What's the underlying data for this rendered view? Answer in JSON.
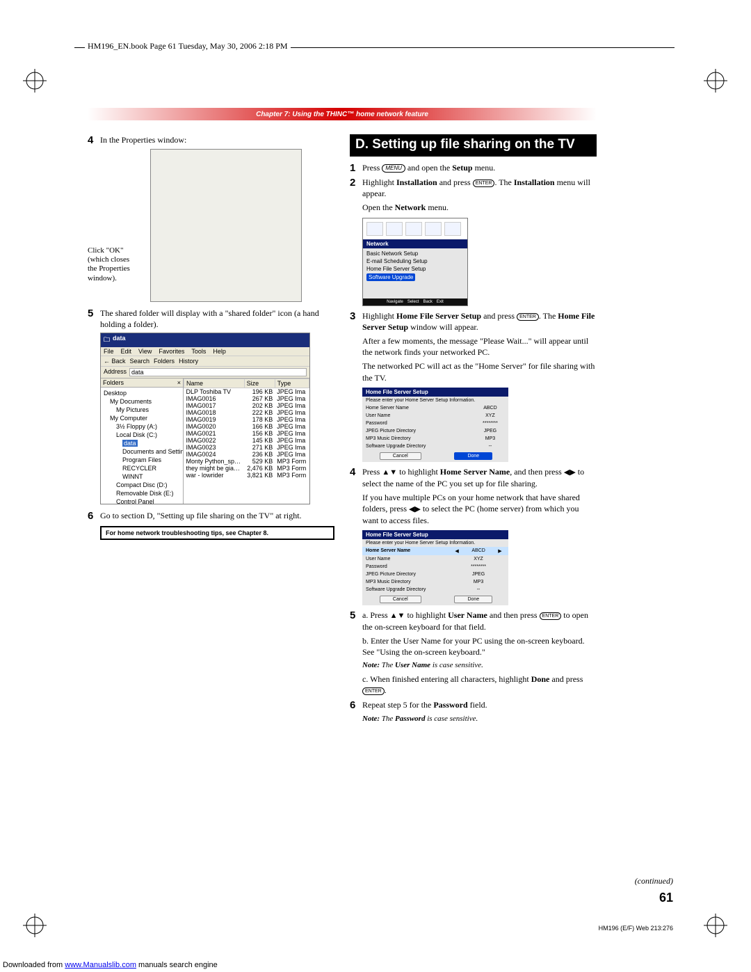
{
  "book_header": "HM196_EN.book  Page 61  Tuesday, May 30, 2006  2:18 PM",
  "chapter_banner": "Chapter 7: Using the THINC™ home network feature",
  "left": {
    "step4_num": "4",
    "step4_text": "In the Properties window:",
    "ok_callout_l1": "Click \"OK\"",
    "ok_callout_l2": "(which closes",
    "ok_callout_l3": "the Properties",
    "ok_callout_l4": "window).",
    "step5_num": "5",
    "step5_text": "The shared folder will display with a \"shared folder\" icon (a hand holding a folder).",
    "explorer": {
      "title": "data",
      "menu": [
        "File",
        "Edit",
        "View",
        "Favorites",
        "Tools",
        "Help"
      ],
      "toolbar": [
        "Back",
        "Search",
        "Folders",
        "History"
      ],
      "addr_label": "Address",
      "addr_value": "data",
      "tree_hdr": "Folders",
      "tree": [
        {
          "lbl": "Desktop",
          "lv": 0
        },
        {
          "lbl": "My Documents",
          "lv": 1
        },
        {
          "lbl": "My Pictures",
          "lv": 2
        },
        {
          "lbl": "My Computer",
          "lv": 1
        },
        {
          "lbl": "3½ Floppy (A:)",
          "lv": 2
        },
        {
          "lbl": "Local Disk (C:)",
          "lv": 2
        },
        {
          "lbl": "data",
          "lv": 3,
          "sel": true
        },
        {
          "lbl": "Documents and Settings",
          "lv": 3
        },
        {
          "lbl": "Program Files",
          "lv": 3
        },
        {
          "lbl": "RECYCLER",
          "lv": 3
        },
        {
          "lbl": "WINNT",
          "lv": 3
        },
        {
          "lbl": "Compact Disc (D:)",
          "lv": 2
        },
        {
          "lbl": "Removable Disk (E:)",
          "lv": 2
        },
        {
          "lbl": "Control Panel",
          "lv": 2
        }
      ],
      "cols": [
        "Name",
        "Size",
        "Type"
      ],
      "rows": [
        {
          "n": "DLP Toshiba TV",
          "s": "196 KB",
          "t": "JPEG Ima"
        },
        {
          "n": "IMAG0016",
          "s": "267 KB",
          "t": "JPEG Ima"
        },
        {
          "n": "IMAG0017",
          "s": "202 KB",
          "t": "JPEG Ima"
        },
        {
          "n": "IMAG0018",
          "s": "222 KB",
          "t": "JPEG Ima"
        },
        {
          "n": "IMAG0019",
          "s": "178 KB",
          "t": "JPEG Ima"
        },
        {
          "n": "IMAG0020",
          "s": "166 KB",
          "t": "JPEG Ima"
        },
        {
          "n": "IMAG0021",
          "s": "156 KB",
          "t": "JPEG Ima"
        },
        {
          "n": "IMAG0022",
          "s": "145 KB",
          "t": "JPEG Ima"
        },
        {
          "n": "IMAG0023",
          "s": "271 KB",
          "t": "JPEG Ima"
        },
        {
          "n": "IMAG0024",
          "s": "236 KB",
          "t": "JPEG Ima"
        },
        {
          "n": "Monty Python_sp…",
          "s": "529 KB",
          "t": "MP3 Form"
        },
        {
          "n": "they might be gia…",
          "s": "2,476 KB",
          "t": "MP3 Form"
        },
        {
          "n": "war - lowrider",
          "s": "3,821 KB",
          "t": "MP3 Form"
        }
      ]
    },
    "step6_num": "6",
    "step6_text": "Go to section D, \"Setting up file sharing on the TV\" at right.",
    "tips_box": "For home network troubleshooting tips, see Chapter 8."
  },
  "right": {
    "heading": "D. Setting up file sharing on the TV",
    "step1_num": "1",
    "step1_pre": "Press ",
    "step1_btn": "MENU",
    "step1_post": " and open the ",
    "step1_setup": "Setup",
    "step1_end": " menu.",
    "step2_num": "2",
    "step2_a": "Highlight ",
    "step2_b": "Installation",
    "step2_c": " and press ",
    "step2_btn": "ENTER",
    "step2_d": ". The ",
    "step2_e": "Installation",
    "step2_f": " menu will appear.",
    "step2_g": "Open the ",
    "step2_h": "Network",
    "step2_i": " menu.",
    "tv_network": {
      "section": "Network",
      "items": [
        "Basic Network Setup",
        "E-mail Scheduling Setup",
        "Home File Server Setup",
        "Software Upgrade"
      ],
      "footer": [
        "Navigate",
        "Select",
        "Back",
        "Exit"
      ]
    },
    "step3_num": "3",
    "step3_a": "Highlight ",
    "step3_b": "Home File Server Setup",
    "step3_c": " and press ",
    "step3_btn": "ENTER",
    "step3_d": ". The ",
    "step3_e": "Home File Server Setup",
    "step3_f": " window will appear.",
    "step3_g": "After a few moments, the message \"Please Wait...\" will appear until the network finds your networked PC.",
    "step3_h": "The networked PC will act as the \"Home Server\" for file sharing with the TV.",
    "tv_form1": {
      "title": "Home File Server Setup",
      "hint": "Please enter your Home Server Setup Information.",
      "rows": [
        {
          "k": "Home Server Name",
          "v": "ABCD"
        },
        {
          "k": "User Name",
          "v": "XYZ"
        },
        {
          "k": "Password",
          "v": "********"
        },
        {
          "k": "JPEG Picture Directory",
          "v": "JPEG"
        },
        {
          "k": "MP3 Music Directory",
          "v": "MP3"
        },
        {
          "k": "Software Upgrade Directory",
          "v": "--"
        }
      ],
      "btn_cancel": "Cancel",
      "btn_done": "Done",
      "sel_idx": -1,
      "done_hl": true
    },
    "step4_num": "4",
    "step4_a": "Press ",
    "step4_b": " to highlight ",
    "step4_c": "Home Server Name",
    "step4_d": ", and then press ",
    "step4_e": " to select the name of the PC you set up for file sharing.",
    "step4_f": "If you have multiple PCs on your home network that have shared folders, press ",
    "step4_g": " to select the PC (home server) from which you want to access files.",
    "tv_form2": {
      "title": "Home File Server Setup",
      "hint": "Please enter your Home Server Setup Information.",
      "rows": [
        {
          "k": "Home Server Name",
          "v": "ABCD",
          "sel": true,
          "arrows": true
        },
        {
          "k": "User Name",
          "v": "XYZ"
        },
        {
          "k": "Password",
          "v": "********"
        },
        {
          "k": "JPEG Picture Directory",
          "v": "JPEG"
        },
        {
          "k": "MP3 Music Directory",
          "v": "MP3"
        },
        {
          "k": "Software Upgrade Directory",
          "v": "--"
        }
      ],
      "btn_cancel": "Cancel",
      "btn_done": "Done"
    },
    "step5_num": "5",
    "step5_a_pre": "a. Press ",
    "step5_a_mid": " to highlight ",
    "step5_a_b": "User Name",
    "step5_a_post": " and then press ",
    "step5_a_btn": "ENTER",
    "step5_a_end": " to open the on-screen keyboard for that field.",
    "step5_b": "b. Enter the User Name for your PC using the on-screen keyboard. See \"Using the on-screen keyboard.\"",
    "step5_note_pre": "Note:",
    "step5_note_mid": " The ",
    "step5_note_b": "User Name",
    "step5_note_end": " is case sensitive.",
    "step5_c_pre": "c. When finished entering all characters, highlight ",
    "step5_c_b": "Done",
    "step5_c_mid": " and press ",
    "step5_c_btn": "ENTER",
    "step5_c_end": ".",
    "step6_num": "6",
    "step6_a": "Repeat step 5 for the ",
    "step6_b": "Password",
    "step6_c": " field.",
    "step6_note_pre": "Note:",
    "step6_note_mid": " The ",
    "step6_note_b": "Password",
    "step6_note_end": " is case sensitive."
  },
  "continued": "(continued)",
  "page_number": "61",
  "footer_code": "HM196 (E/F) Web 213:276",
  "download_pre": "Downloaded from ",
  "download_link": "www.Manualslib.com",
  "download_post": " manuals search engine"
}
